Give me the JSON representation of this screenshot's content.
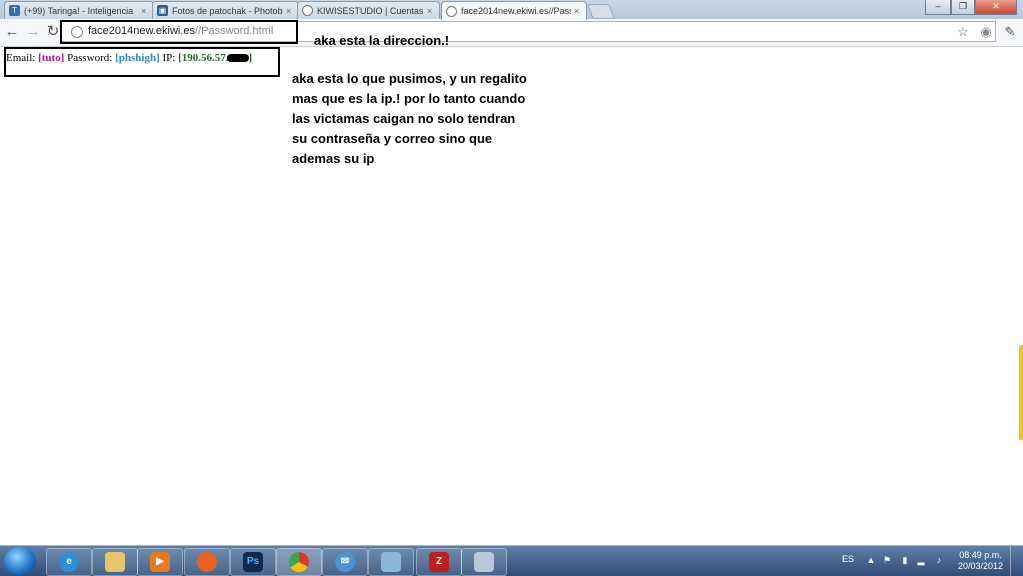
{
  "tabs": [
    {
      "title": "(+99) Taringa! - Inteligencia",
      "favicon": "taringa-icon",
      "active": false
    },
    {
      "title": "Fotos de patochak - Photob",
      "favicon": "photobucket-icon",
      "active": false
    },
    {
      "title": "KIWISESTUDIO | Cuentas",
      "favicon": "globe-icon",
      "active": false
    },
    {
      "title": "face2014new.ekiwi.es//Pass",
      "favicon": "globe-icon",
      "active": true
    }
  ],
  "toolbar": {
    "url_host": "face2014new.ekiwi.es",
    "url_path": "//Password.html"
  },
  "page": {
    "email_label": "Email:",
    "email_value": "[tuto]",
    "password_label": "Password:",
    "password_value": "[phshigh]",
    "ip_label": "IP:",
    "ip_value": "[190.56.57.",
    "ip_end": "]"
  },
  "annotations": {
    "note1": "aka esta la direccion.!",
    "note2": "aka esta lo que pusimos, y un regalito mas que es la ip.! por lo tanto cuando las victamas caigan no solo tendran su contraseña y correo sino que ademas su ip"
  },
  "taskbar": {
    "lang": "ES",
    "time": "08:49 p.m.",
    "date": "20/03/2012"
  },
  "colors": {
    "email": "#c0148a",
    "password": "#3b86c4",
    "ip": "#246b2a"
  }
}
